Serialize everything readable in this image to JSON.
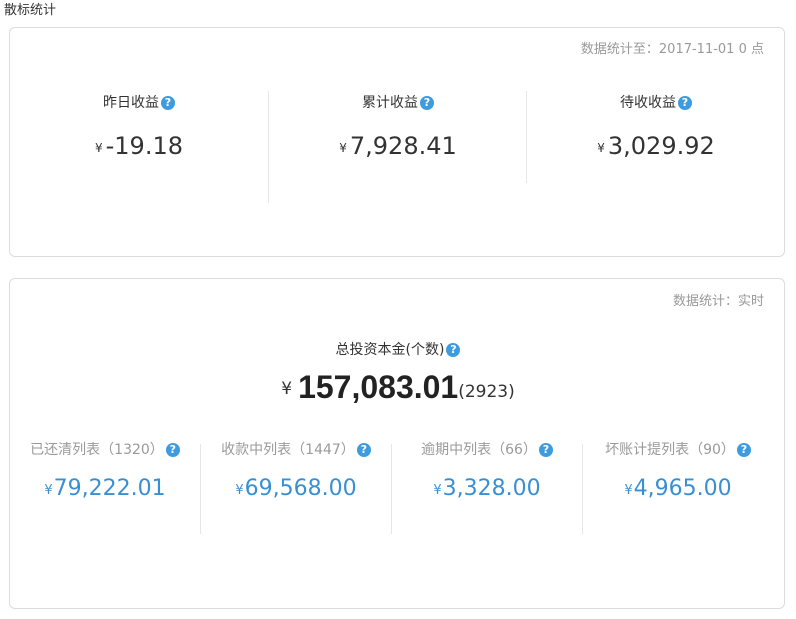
{
  "page_title": "散标统计",
  "top_card": {
    "stat_note": "数据统计至：2017-11-01 0 点",
    "metrics": [
      {
        "label": "昨日收益",
        "currency": "¥",
        "value": "-19.18"
      },
      {
        "label": "累计收益",
        "currency": "¥",
        "value": "7,928.41"
      },
      {
        "label": "待收收益",
        "currency": "¥",
        "value": "3,029.92"
      }
    ]
  },
  "bottom_card": {
    "stat_note": "数据统计：实时",
    "total": {
      "label": "总投资本金(个数)",
      "currency": "¥",
      "value": "157,083.01",
      "count": "(2923)"
    },
    "lists": [
      {
        "label": "已还清列表（1320）",
        "currency": "¥",
        "value": "79,222.01"
      },
      {
        "label": "收款中列表（1447）",
        "currency": "¥",
        "value": "69,568.00"
      },
      {
        "label": "逾期中列表（66）",
        "currency": "¥",
        "value": "3,328.00"
      },
      {
        "label": "坏账计提列表（90）",
        "currency": "¥",
        "value": "4,965.00"
      }
    ]
  },
  "help_icon_glyph": "?",
  "colors": {
    "accent": "#3a8fd3",
    "help_icon": "#3d9be0",
    "muted_text": "#999999",
    "border": "#dcdcdc"
  }
}
